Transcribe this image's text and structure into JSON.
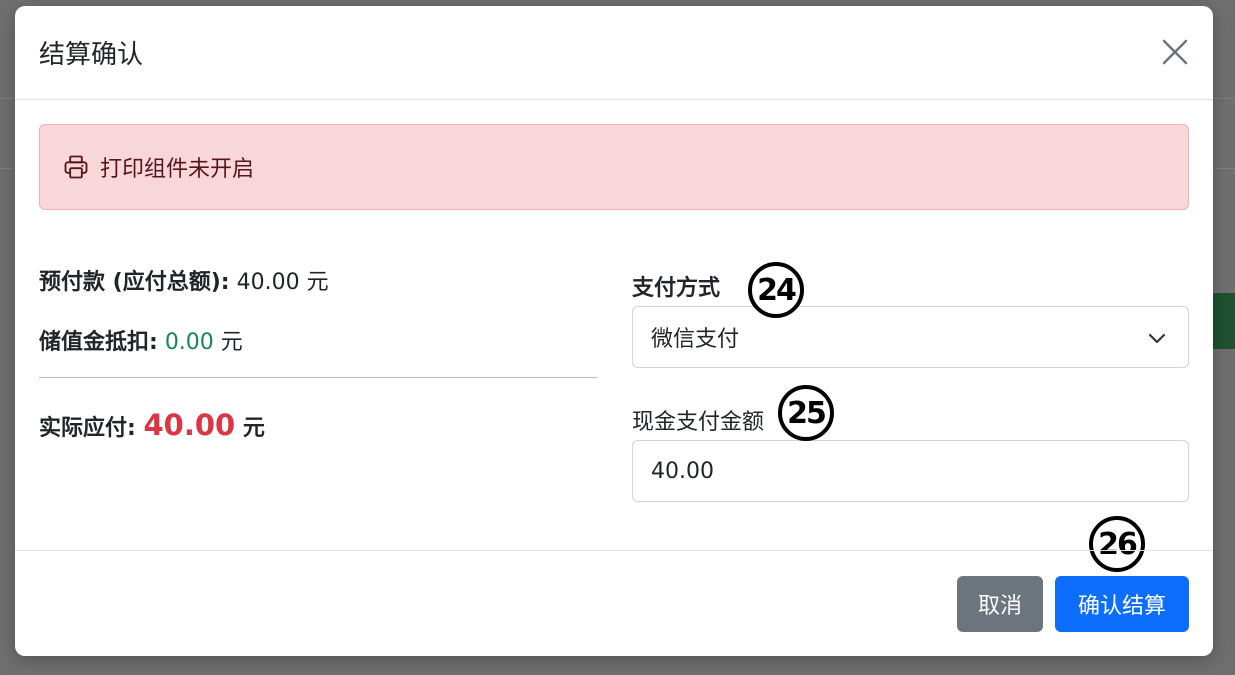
{
  "modal": {
    "title": "结算确认",
    "close_icon": "close-icon"
  },
  "alert": {
    "icon": "printer-icon",
    "text": "打印组件未开启",
    "color": "#f8d7da"
  },
  "summary": {
    "prepaid_label": "预付款 (应付总额):",
    "prepaid_value": "40.00",
    "prepaid_unit": "元",
    "stored_label": "储值金抵扣:",
    "stored_value": "0.00",
    "stored_unit": "元",
    "actual_label": "实际应付:",
    "actual_value": "40.00",
    "actual_unit": "元"
  },
  "payment": {
    "method_label": "支付方式",
    "method_selected": "微信支付",
    "cash_label": "现金支付金额",
    "cash_value": "40.00"
  },
  "markers": {
    "m24": "24",
    "m25": "25",
    "m26": "26"
  },
  "footer": {
    "cancel_label": "取消",
    "confirm_label": "确认结算"
  },
  "colors": {
    "primary": "#0d6efd",
    "secondary": "#6c757d",
    "danger": "#dc3545",
    "success": "#198754"
  }
}
